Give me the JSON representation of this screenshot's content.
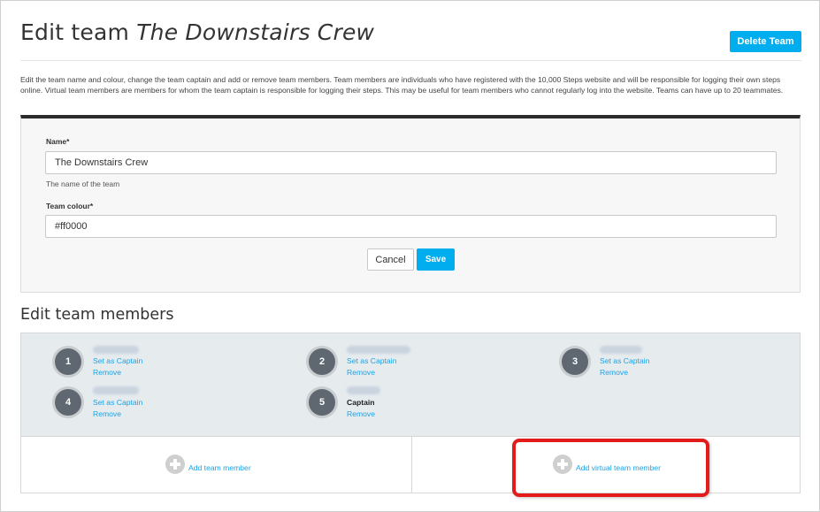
{
  "page": {
    "title_prefix": "Edit team",
    "title_team": "The Downstairs Crew",
    "delete_label": "Delete Team",
    "description": "Edit the team name and colour, change the team captain and add or remove team members. Team members are individuals who have registered with the 10,000 Steps website and will be responsible for logging their own steps online. Virtual team members are members for whom the team captain is responsible for logging their steps. This may be useful for team members who cannot regularly log into the website. Teams can have up to 20 teammates."
  },
  "form": {
    "name_label": "Name*",
    "name_value": "The Downstairs Crew",
    "name_hint": "The name of the team",
    "colour_label": "Team colour*",
    "colour_value": "#ff0000",
    "cancel_label": "Cancel",
    "save_label": "Save"
  },
  "members": {
    "title": "Edit team members",
    "set_captain_label": "Set as Captain",
    "remove_label": "Remove",
    "captain_label": "Captain",
    "items": [
      {
        "number": "1",
        "is_captain": false
      },
      {
        "number": "2",
        "is_captain": false
      },
      {
        "number": "3",
        "is_captain": false
      },
      {
        "number": "4",
        "is_captain": false
      },
      {
        "number": "5",
        "is_captain": true
      }
    ],
    "add_member_label": "Add team member",
    "add_virtual_label": "Add virtual team member"
  },
  "colors": {
    "accent": "#00aeef",
    "link": "#1aa3e8",
    "highlight": "#e21b1b",
    "badge": "#5f6770"
  },
  "icons": {
    "add_member": "plus-circle-icon",
    "add_virtual": "plus-circle-icon"
  }
}
